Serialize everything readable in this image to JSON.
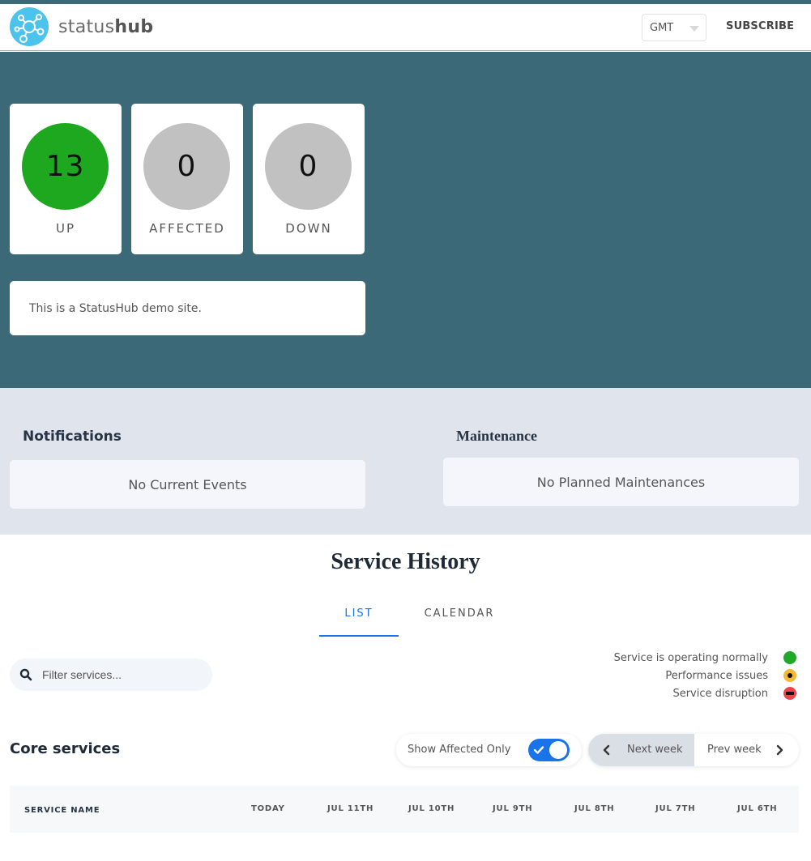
{
  "header": {
    "brand_light": "status",
    "brand_bold": "hub",
    "timezone": "GMT",
    "subscribe_label": "SUBSCRIBE"
  },
  "stats": [
    {
      "value": "13",
      "label": "UP",
      "color": "#1ea81f"
    },
    {
      "value": "0",
      "label": "AFFECTED",
      "color": "#c1c1c1"
    },
    {
      "value": "0",
      "label": "DOWN",
      "color": "#c1c1c1"
    }
  ],
  "announcement": "This is a StatusHub demo site.",
  "notifications": {
    "title": "Notifications",
    "empty_text": "No Current Events"
  },
  "maintenance": {
    "title": "Maintenance",
    "empty_text": "No Planned Maintenances"
  },
  "history": {
    "title": "Service History",
    "tabs": [
      {
        "label": "LIST",
        "active": true
      },
      {
        "label": "CALENDAR",
        "active": false
      }
    ],
    "filter_placeholder": "Filter services...",
    "legend": [
      {
        "label": "Service is operating normally",
        "status": "operational",
        "color": "#1fa82a"
      },
      {
        "label": "Performance issues",
        "status": "degraded",
        "color": "#f7b731"
      },
      {
        "label": "Service disruption",
        "status": "disruption",
        "color": "#ee4450"
      }
    ],
    "group_title": "Core services",
    "show_affected_label": "Show Affected Only",
    "show_affected_on": true,
    "next_week_label": "Next week",
    "prev_week_label": "Prev week",
    "columns": [
      "SERVICE NAME",
      "TODAY",
      "JUL 11TH",
      "JUL 10TH",
      "JUL 9TH",
      "JUL 8TH",
      "JUL 7TH",
      "JUL 6TH"
    ]
  },
  "colors": {
    "hero_bg": "#3b6978",
    "events_bg": "#e0e4ed",
    "accent": "#1a73e8"
  }
}
